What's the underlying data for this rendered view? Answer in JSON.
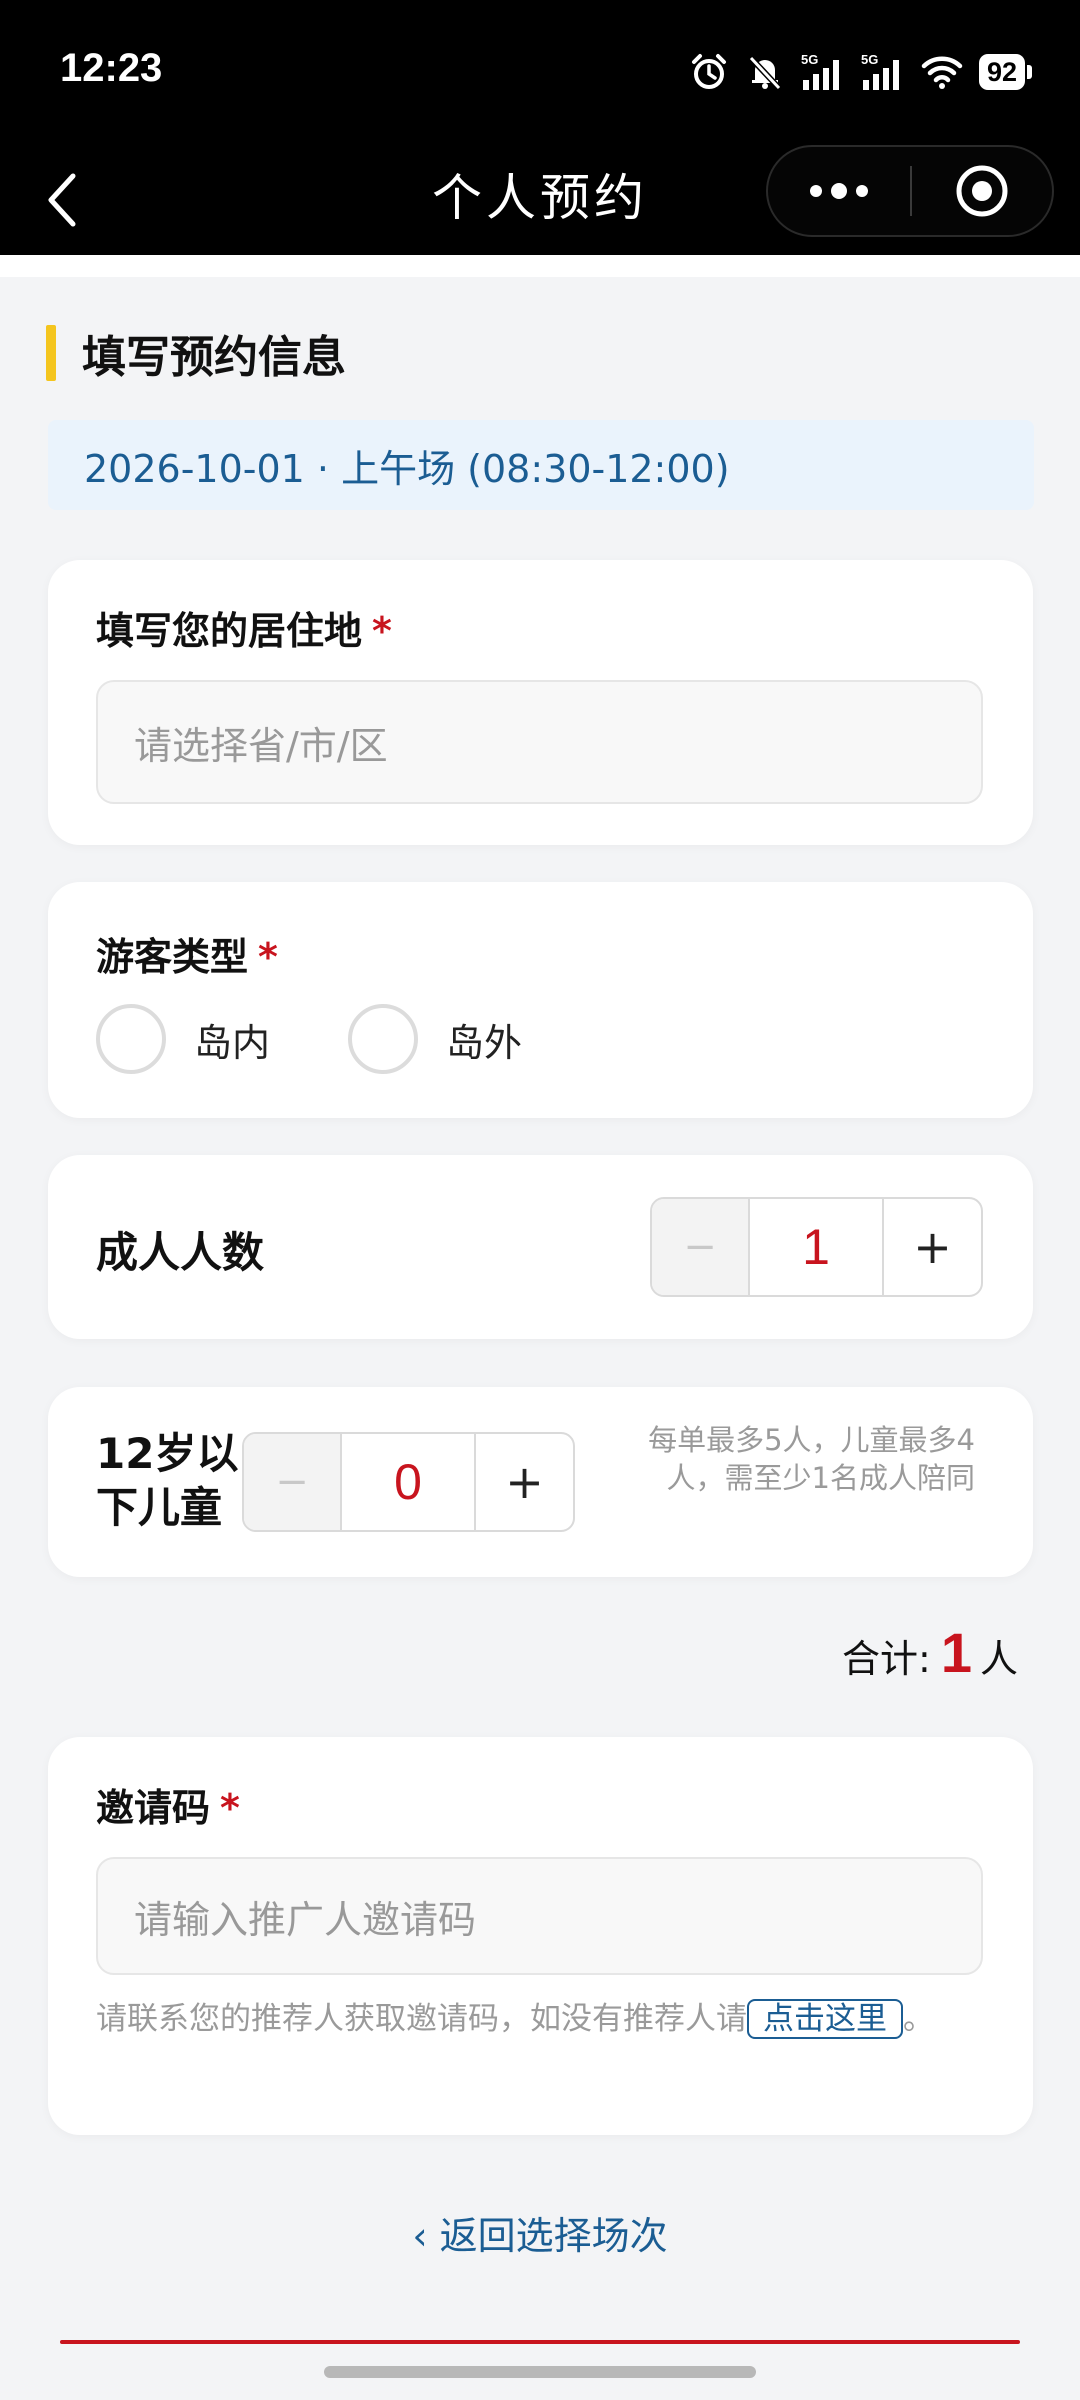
{
  "status_bar": {
    "time": "12:23",
    "battery": "92"
  },
  "nav": {
    "title": "个人预约"
  },
  "section": {
    "title": "填写预约信息"
  },
  "session": {
    "date_label": "2026-10-01 · 上午场 (08:30-12:00)"
  },
  "residence": {
    "label": "填写您的居住地",
    "required_mark": "*",
    "placeholder": "请选择省/市/区"
  },
  "visitor_type": {
    "label": "游客类型",
    "required_mark": "*",
    "options": [
      "岛内",
      "岛外"
    ]
  },
  "adults": {
    "label": "成人人数",
    "minus": "−",
    "value": "1",
    "plus": "+"
  },
  "children": {
    "label_line1": "12岁以",
    "label_line2": "下儿童",
    "minus": "−",
    "value": "0",
    "plus": "+",
    "hint_line1": "每单最多5人，儿童最多4",
    "hint_line2": "人，需至少1名成人陪同"
  },
  "total": {
    "prefix": "合计:",
    "value": "1",
    "unit": "人"
  },
  "invite": {
    "label": "邀请码",
    "required_mark": "*",
    "placeholder": "请输入推广人邀请码",
    "note": "请联系您的推荐人获取邀请码，如没有推荐人请",
    "link": "点击这里",
    "note_end": "。"
  },
  "footer": {
    "back_link": "‹ 返回选择场次"
  },
  "colors": {
    "accent": "#c8141e",
    "link": "#1b5d93",
    "section_bar": "#f4c51e",
    "banner_bg": "#eaf3fc"
  }
}
